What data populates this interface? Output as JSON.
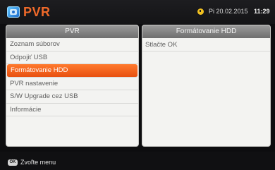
{
  "header": {
    "icon": "pvr-app-icon",
    "title": "PVR",
    "clock_icon": "clock-icon",
    "date": "Pi 20.02.2015",
    "time": "11:29"
  },
  "left_panel": {
    "title": "PVR",
    "items": [
      {
        "label": "Zoznam súborov",
        "selected": false
      },
      {
        "label": "Odpojiť USB",
        "selected": false
      },
      {
        "label": "Formátovanie HDD",
        "selected": true
      },
      {
        "label": "PVR nastavenie",
        "selected": false
      },
      {
        "label": "S/W Upgrade cez USB",
        "selected": false
      },
      {
        "label": "Informácie",
        "selected": false
      }
    ]
  },
  "right_panel": {
    "title": "Formátovanie HDD",
    "text": "Stlačte OK"
  },
  "footer": {
    "key_label": "OK",
    "action_label": "Zvoľte menu"
  },
  "colors": {
    "accent": "#f06a2a",
    "selected": "#ff7a2e"
  }
}
